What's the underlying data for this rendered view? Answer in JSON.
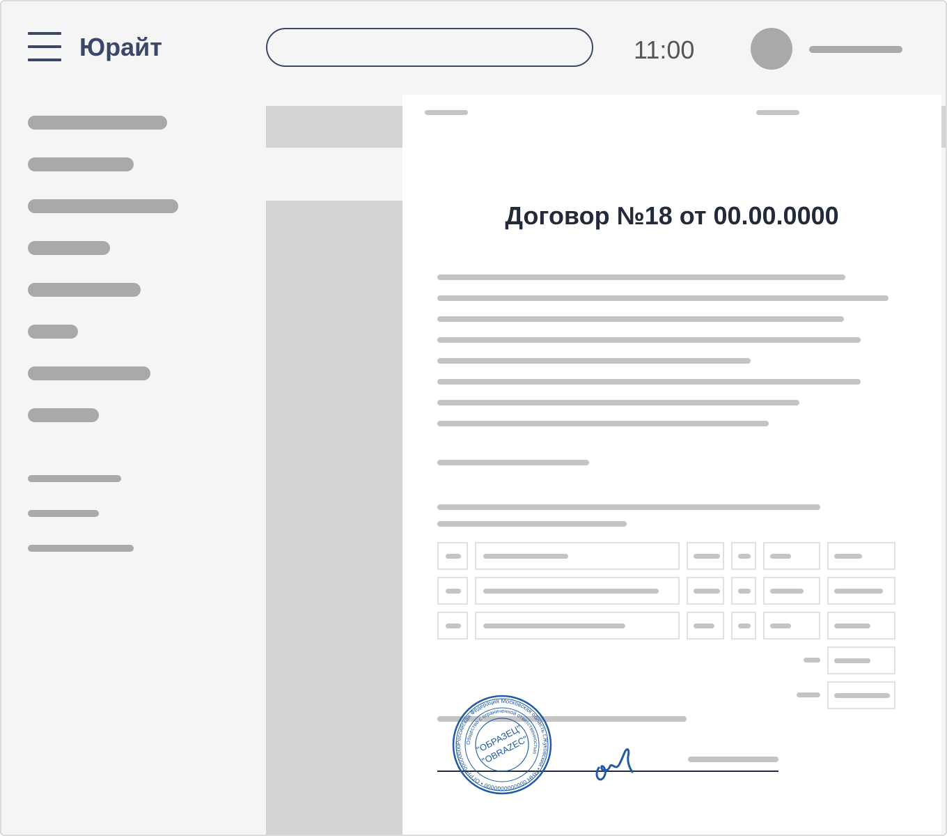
{
  "header": {
    "brand": "Юрайт",
    "time": "11:00",
    "search_value": "",
    "menu_icon": "hamburger-icon"
  },
  "document": {
    "title": "Договор №18 от 00.00.0000",
    "stamp_outer_text": "Российская Федерация Московская область г.Жуковский • ИНН 0000000000000 • ОГРН 0000000000000 •",
    "stamp_inner_text": "Общество с ограниченной ответственностью",
    "stamp_center_line1": "\"ОБРАЗЕЦ\"",
    "stamp_center_line2": "\"OBRAZEC\""
  },
  "colors": {
    "accent": "#3a4766",
    "stamp": "#1f5aa6",
    "placeholder": "#a9a9a9"
  }
}
